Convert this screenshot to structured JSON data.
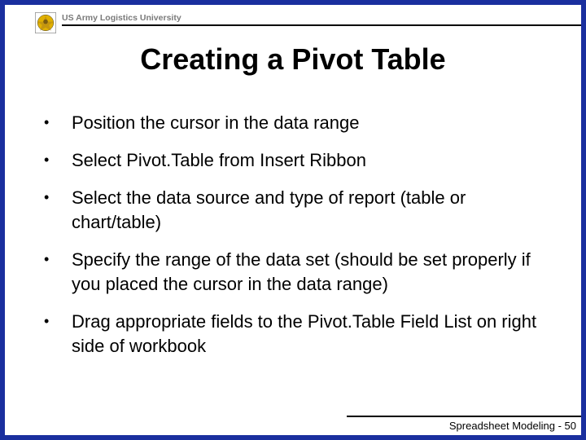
{
  "header": {
    "org_text": "US Army Logistics University"
  },
  "title": "Creating a Pivot Table",
  "bullets": [
    "Position the cursor in the data range",
    "Select Pivot.Table from Insert Ribbon",
    "Select the data source and type of report (table or chart/table)",
    "Specify the range of the data set (should be set properly if you placed the cursor in the data range)",
    "Drag appropriate fields to the Pivot.Table Field List on right side of workbook"
  ],
  "footer": "Spreadsheet Modeling - 50"
}
